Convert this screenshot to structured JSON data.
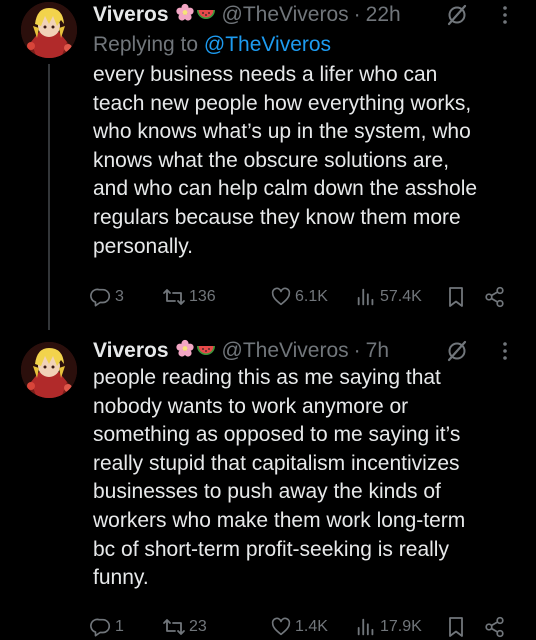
{
  "tweets": [
    {
      "name": "Viveros",
      "handle": "@TheViveros",
      "separator": "·",
      "time": "22h",
      "reply_label": "Replying to ",
      "reply_to": "@TheViveros",
      "text": "every business needs a lifer who can\nteach new people how everything works,\nwho knows what’s up in the system, who\nknows what the obscure solutions are,\nand who can help calm down the asshole\nregulars because they know them more\npersonally.",
      "replies": "3",
      "reposts": "136",
      "likes": "6.1K",
      "views": "57.4K"
    },
    {
      "name": "Viveros",
      "handle": "@TheViveros",
      "separator": "·",
      "time": "7h",
      "text": "people reading this as me saying that\nnobody wants to work anymore or\nsomething as opposed to me saying it’s\nreally stupid that capitalism incentivizes\nbusinesses to push away the kinds of\nworkers who make them work long-term\nbc of short-term profit-seeking is really\nfunny.",
      "replies": "1",
      "reposts": "23",
      "likes": "1.4K",
      "views": "17.9K"
    }
  ],
  "icons": {
    "name_emojis": [
      "cherry-blossom-icon",
      "watermelon-slice-icon"
    ],
    "header": [
      "grok-icon",
      "more-icon"
    ],
    "actions": [
      "reply-icon",
      "repost-icon",
      "like-icon",
      "views-icon",
      "bookmark-icon",
      "share-icon"
    ]
  },
  "colors": {
    "background": "#000000",
    "text": "#e7e9ea",
    "muted": "#71767b",
    "link": "#1d9bf0",
    "thread_line": "#333639"
  }
}
